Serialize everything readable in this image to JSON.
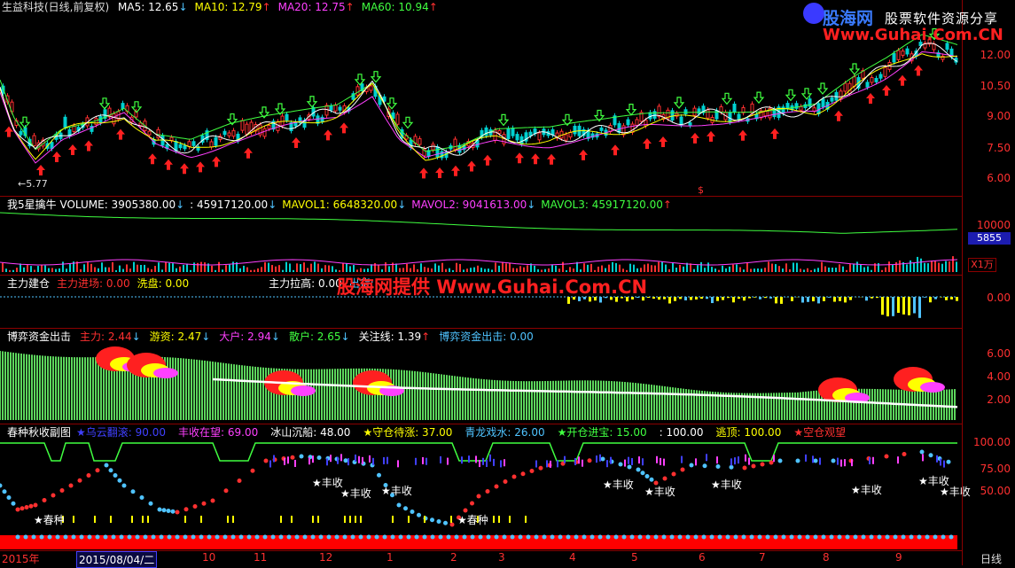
{
  "main": {
    "stock": "生益科技(日线,前复权)",
    "items": [
      {
        "label": "MA5: 12.65",
        "arrow": "↓",
        "color": "#ffffff",
        "arrow_color": "#4fc3ff"
      },
      {
        "label": "MA10: 12.79",
        "arrow": "↑",
        "color": "#ffff00",
        "arrow_color": "#ff3030"
      },
      {
        "label": "MA20: 12.75",
        "arrow": "↑",
        "color": "#ff40ff",
        "arrow_color": "#ff3030"
      },
      {
        "label": "MA60: 10.94",
        "arrow": "↑",
        "color": "#40ff40",
        "arrow_color": "#ff3030"
      }
    ],
    "low_label": "5.77",
    "dollar": "$",
    "yticks": [
      "12.00",
      "10.50",
      "9.00",
      "7.50",
      "6.00"
    ]
  },
  "volume": {
    "items": [
      {
        "label": "我5星擒牛 VOLUME: 3905380.00",
        "arrow": "↓",
        "color": "#ffffff",
        "arrow_color": "#4fc3ff"
      },
      {
        "label": ": 45917120.00",
        "arrow": "↓",
        "color": "#ffffff",
        "arrow_color": "#4fc3ff"
      },
      {
        "label": "MAVOL1: 6648320.00",
        "arrow": "↓",
        "color": "#ffff00",
        "arrow_color": "#4fc3ff"
      },
      {
        "label": "MAVOL2: 9041613.00",
        "arrow": "↓",
        "color": "#ff40ff",
        "arrow_color": "#4fc3ff"
      },
      {
        "label": "MAVOL3: 45917120.00",
        "arrow": "↑",
        "color": "#40ff40",
        "arrow_color": "#ff3030"
      }
    ],
    "yticks": [
      "10000",
      "5855"
    ],
    "unit": "X1万"
  },
  "zhuli": {
    "items": [
      {
        "label": "主力建仓",
        "color": "#ffffff"
      },
      {
        "label": "主力进场: 0.00",
        "color": "#ff3030"
      },
      {
        "label": "洗盘: 0.00",
        "color": "#ffff00"
      },
      {
        "label": "主力拉高: 0.00",
        "color": "#ffffff"
      },
      {
        "label": "出货:",
        "color": "#4fc3ff"
      }
    ],
    "watermark": "股海网提供 Www.Guhai.Com.CN",
    "yticks": [
      "0.00"
    ]
  },
  "boyi": {
    "items": [
      {
        "label": "博弈资金出击",
        "arrow": "",
        "color": "#ffffff"
      },
      {
        "label": "主力: 2.44",
        "arrow": "↓",
        "color": "#ff3030",
        "arrow_color": "#4fc3ff"
      },
      {
        "label": "游资: 2.47",
        "arrow": "↓",
        "color": "#ffff00",
        "arrow_color": "#4fc3ff"
      },
      {
        "label": "大户: 2.94",
        "arrow": "↓",
        "color": "#ff40ff",
        "arrow_color": "#4fc3ff"
      },
      {
        "label": "散户: 2.65",
        "arrow": "↓",
        "color": "#40ff40",
        "arrow_color": "#4fc3ff"
      },
      {
        "label": "关注线: 1.39",
        "arrow": "↑",
        "color": "#ffffff",
        "arrow_color": "#ff3030"
      },
      {
        "label": "博弈资金出击: 0.00",
        "arrow": "",
        "color": "#4fc3ff"
      }
    ],
    "yticks": [
      "6.00",
      "4.00",
      "2.00"
    ]
  },
  "chunzhong": {
    "items": [
      {
        "label": "春种秋收副图",
        "color": "#ffffff"
      },
      {
        "label": "★乌云翻滚: 90.00",
        "color": "#4040ff"
      },
      {
        "label": "丰收在望: 69.00",
        "color": "#ff40ff"
      },
      {
        "label": "冰山沉船: 48.00",
        "color": "#ffffff"
      },
      {
        "label": "★守仓待涨: 37.00",
        "color": "#ffff00"
      },
      {
        "label": "青龙戏水: 26.00",
        "color": "#4fc3ff"
      },
      {
        "label": "★开仓进宝: 15.00",
        "color": "#40ff40"
      },
      {
        "label": ": 100.00",
        "color": "#ffffff"
      },
      {
        "label": "逃顶: 100.00",
        "color": "#ffff00"
      },
      {
        "label": "★空仓观望",
        "color": "#ff3030"
      }
    ],
    "yticks": [
      "100.00",
      "75.00",
      "50.00"
    ],
    "signals": [
      {
        "text": "★春种",
        "x": 38,
        "y": 578
      },
      {
        "text": "★丰收",
        "x": 352,
        "y": 536
      },
      {
        "text": "★丰收",
        "x": 384,
        "y": 548
      },
      {
        "text": "★丰收",
        "x": 430,
        "y": 545
      },
      {
        "text": "★春种",
        "x": 516,
        "y": 578
      },
      {
        "text": "★丰收",
        "x": 680,
        "y": 538
      },
      {
        "text": "★丰收",
        "x": 727,
        "y": 546
      },
      {
        "text": "★丰收",
        "x": 802,
        "y": 538
      },
      {
        "text": "★丰收",
        "x": 960,
        "y": 544
      },
      {
        "text": "★丰收",
        "x": 1036,
        "y": 534
      },
      {
        "text": "★丰收",
        "x": 1060,
        "y": 546
      }
    ]
  },
  "xaxis": {
    "labels": [
      "2015年",
      "2015/08/04/二",
      "10",
      "11",
      "12",
      "1",
      "2",
      "3",
      "4",
      "5",
      "6",
      "7",
      "8",
      "9"
    ],
    "period": "日线"
  },
  "logo": {
    "name": "股海网",
    "slogan": "股票软件资源分享",
    "url": "Www.Guhai.Com.CN"
  },
  "colors": {
    "bg": "#000000",
    "up": "#ff0000",
    "down": "#00cc00",
    "axis": "#8b0000"
  }
}
